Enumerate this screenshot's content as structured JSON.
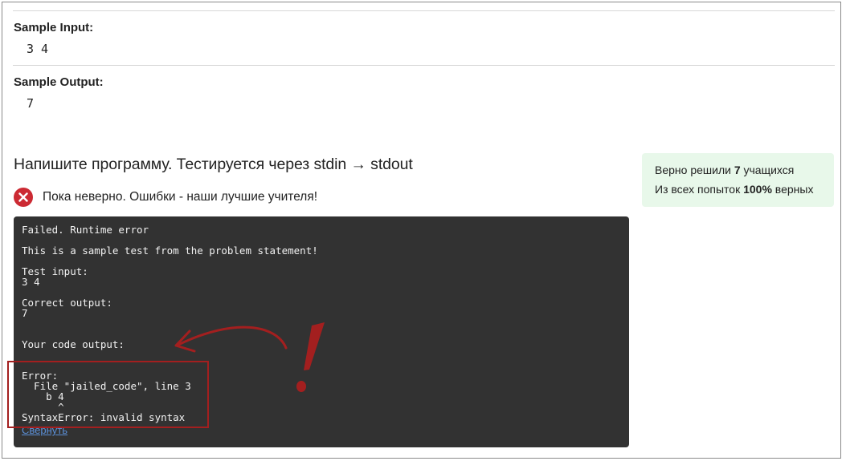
{
  "sample_input": {
    "label": "Sample Input:",
    "value": "3 4"
  },
  "sample_output": {
    "label": "Sample Output:",
    "value": "7"
  },
  "task": {
    "title": "Напишите программу. Тестируется через stdin → stdout"
  },
  "status": {
    "icon": "error-x-icon",
    "text": "Пока неверно. Ошибки - наши лучшие учителя!",
    "color": "#cc2a33"
  },
  "console": {
    "lines": [
      "Failed. Runtime error",
      "This is a sample test from the problem statement!",
      "Test input:",
      "3 4",
      "Correct output:",
      "7",
      "Your code output:",
      "Error:",
      "  File \"jailed_code\", line 3",
      "    b 4",
      "      ^",
      "SyntaxError: invalid syntax"
    ],
    "collapse_label": "Свернуть"
  },
  "stats": {
    "solved_prefix": "Верно решили ",
    "solved_count": "7",
    "solved_suffix": " учащихся",
    "attempts_prefix": "Из всех попыток ",
    "attempts_percent": "100%",
    "attempts_suffix": " верных",
    "background": "#e8f8ea"
  },
  "annotation": {
    "color": "#a31f1f",
    "mark": "!"
  }
}
